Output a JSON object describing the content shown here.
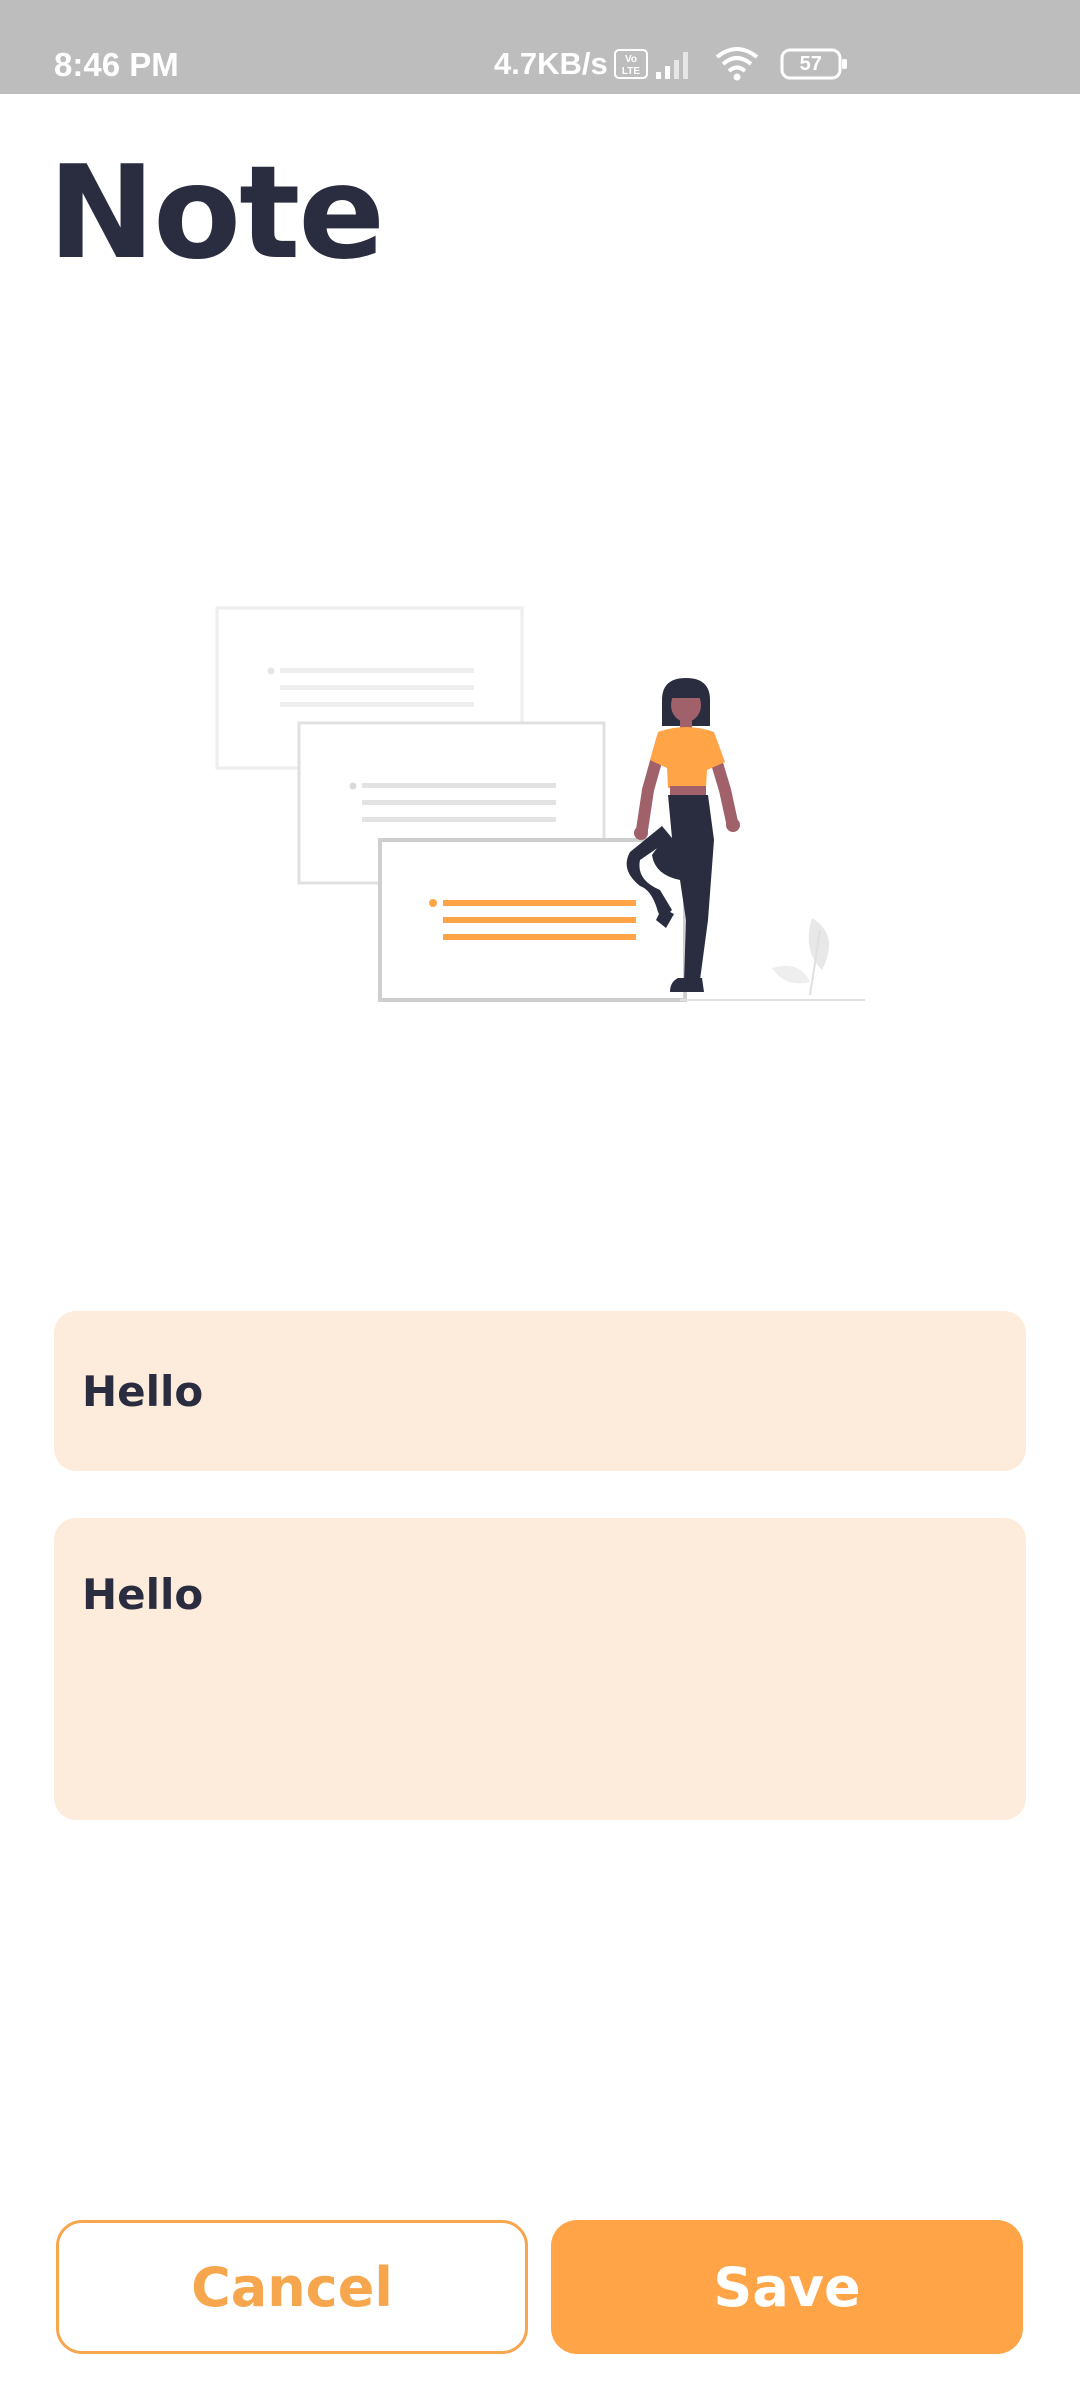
{
  "status_bar": {
    "time": "8:46 PM",
    "net_speed": "4.7KB/s",
    "battery_level": "57",
    "icons": [
      "volte-icon",
      "signal-icon",
      "wifi-icon",
      "battery-icon"
    ]
  },
  "page": {
    "title": "Note"
  },
  "form": {
    "title_value": "Hello",
    "body_value": "Hello"
  },
  "actions": {
    "cancel_label": "Cancel",
    "save_label": "Save"
  },
  "colors": {
    "accent": "#ffa548",
    "field_bg": "#fdecdb",
    "text_dark": "#2a2c40",
    "status_bar": "#bdbdbd"
  }
}
